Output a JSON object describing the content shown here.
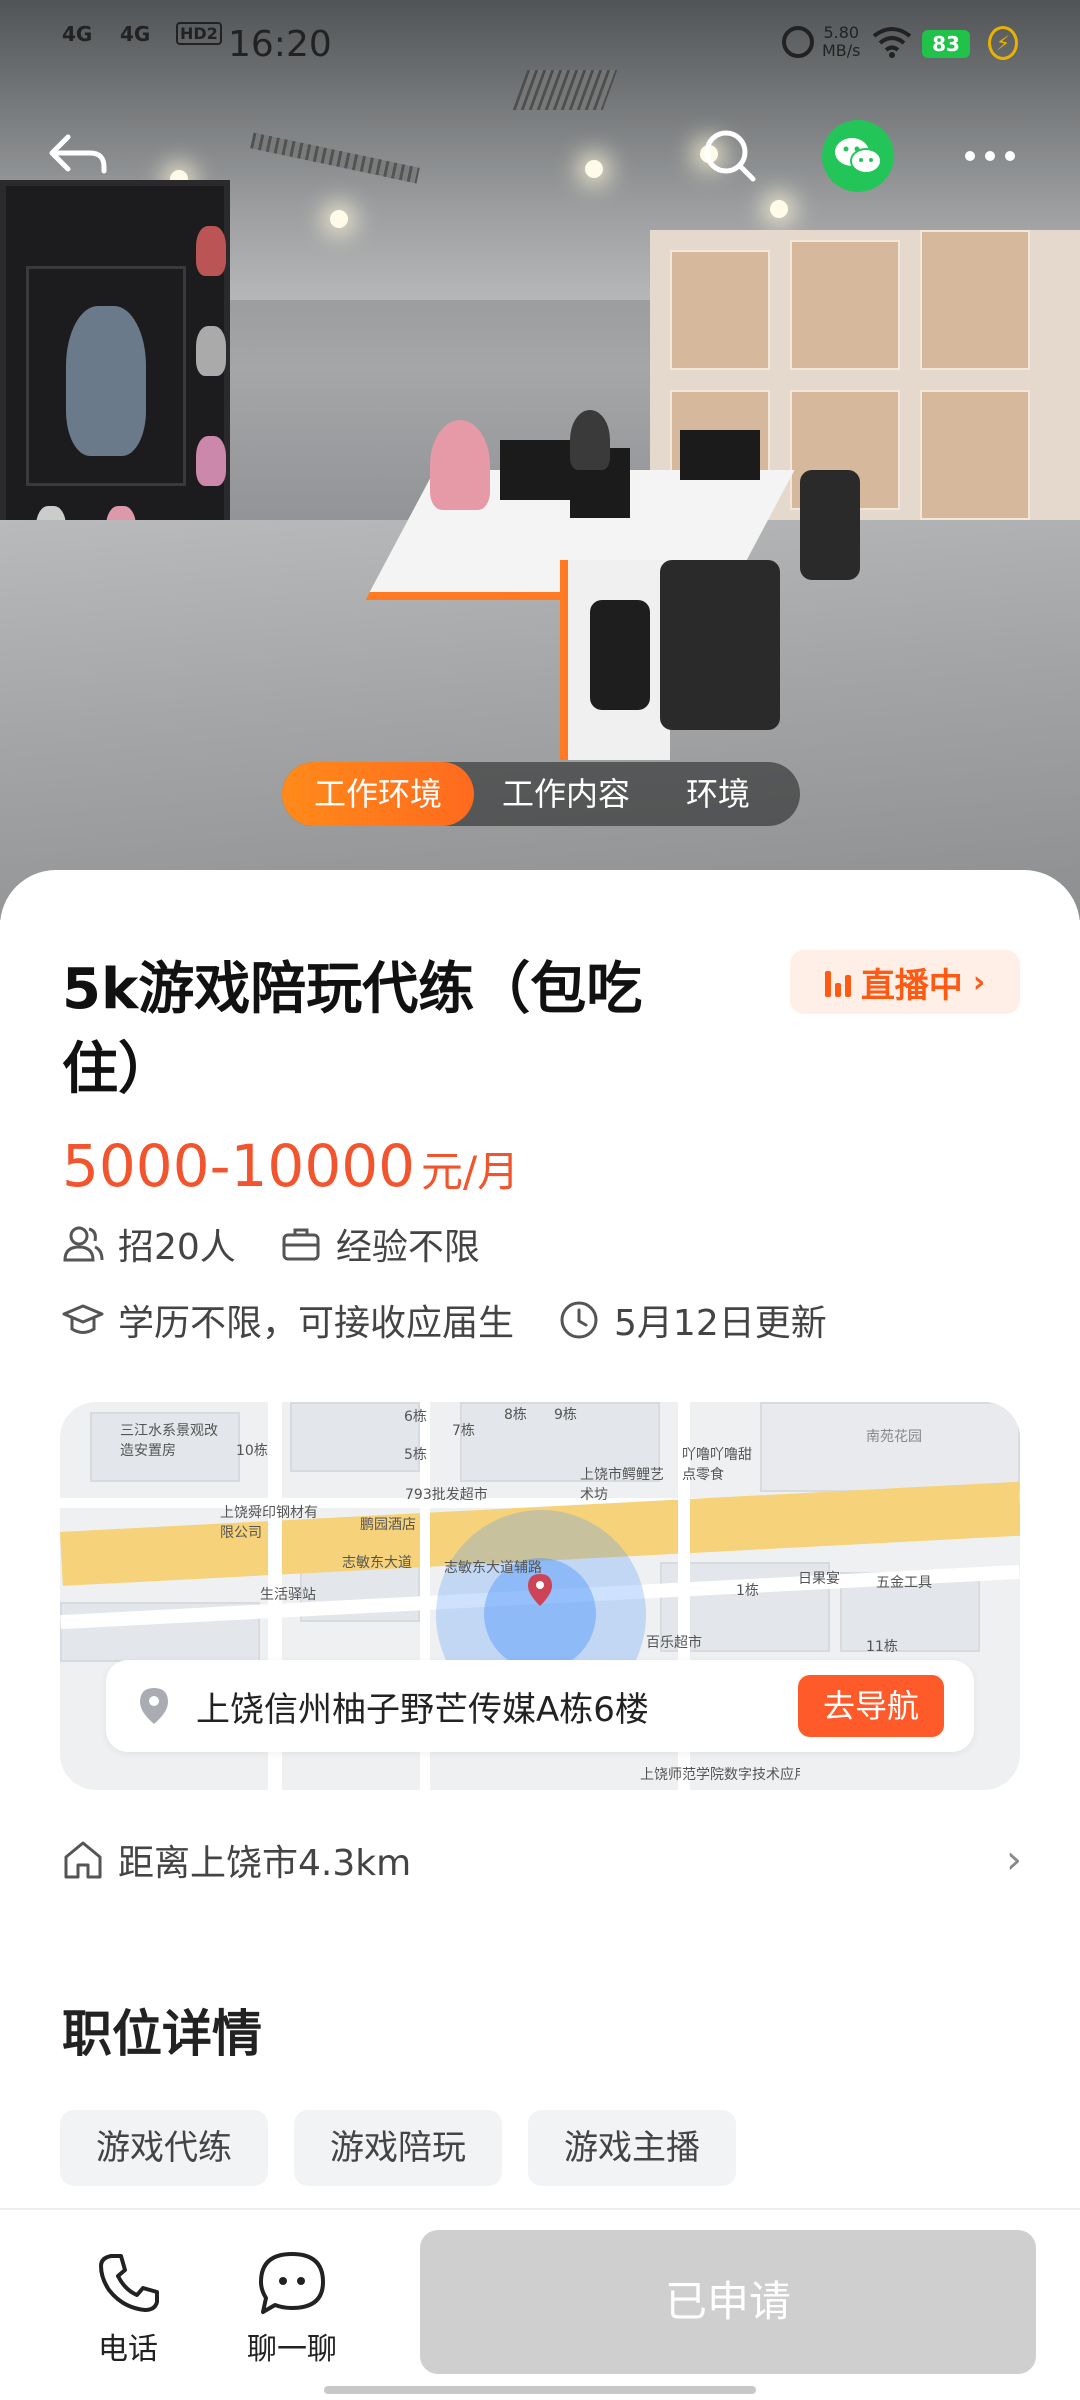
{
  "status_bar": {
    "net1": "4G",
    "net2": "4G",
    "hd": "HD2",
    "time": "16:20",
    "speed_value": "5.80",
    "speed_unit": "MB/s",
    "battery": "83"
  },
  "header": {
    "back_icon": "back-arrow-icon",
    "search_icon": "search-icon",
    "share_icon": "wechat-icon",
    "more_icon": "more-dots-icon"
  },
  "gallery": {
    "tabs": [
      "工作环境",
      "工作内容",
      "环境"
    ],
    "active_tab": 0
  },
  "job": {
    "title": "5k游戏陪玩代练（包吃住）",
    "live_label": "直播中",
    "salary": "5000-10000",
    "salary_unit": "元/月",
    "headcount": "招20人",
    "experience": "经验不限",
    "education": "学历不限，可接收应届生",
    "updated": "5月12日更新"
  },
  "map": {
    "address": "上饶信州柚子野芒传媒A栋6楼",
    "navigate_label": "去导航",
    "labels": [
      "三江水系景观改造安置房",
      "南苑花园",
      "上饶市鳄鲤艺术坊",
      "吖噜吖噜甜点零食",
      "793批发超市",
      "上饶舜印钢材有限公司",
      "鹏园酒店",
      "志敏东大道",
      "志敏东大道辅路",
      "生活驿站",
      "百乐超市",
      "日果宴",
      "五金工具",
      "上饶师范学院数字技术应用产业学院",
      "10栋",
      "6栋",
      "7栋",
      "8栋",
      "9栋",
      "5栋",
      "1栋",
      "11栋"
    ]
  },
  "distance": "距离上饶市4.3km",
  "details": {
    "section_title": "职位详情",
    "tags": [
      "游戏代练",
      "游戏陪玩",
      "游戏主播"
    ]
  },
  "bottom_bar": {
    "phone_label": "电话",
    "chat_label": "聊一聊",
    "apply_label": "已申请"
  },
  "colors": {
    "accent": "#ff5a14",
    "salary": "#f2542d",
    "tab_active": "#ff7a1e",
    "wechat": "#24c558",
    "apply_disabled": "#cfcfcf"
  }
}
